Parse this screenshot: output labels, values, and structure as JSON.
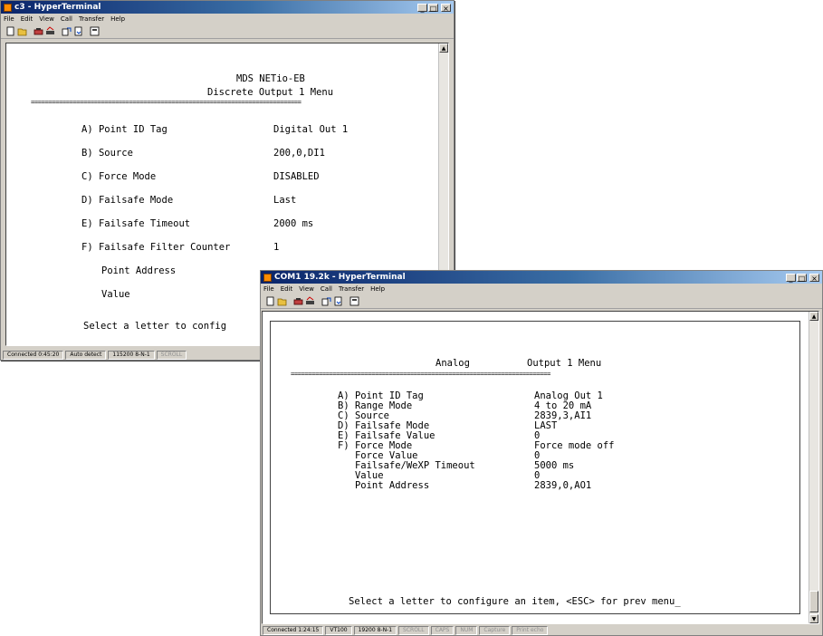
{
  "back_window": {
    "title": "c3 - HyperTerminal",
    "menu": [
      "File",
      "Edit",
      "View",
      "Call",
      "Transfer",
      "Help"
    ],
    "header_line1": "MDS NETio-EB",
    "header_line2": "Discrete Output 1 Menu",
    "separator": "=============================================================================",
    "items": [
      {
        "key": "A) Point ID Tag",
        "value": "Digital Out 1"
      },
      {
        "key": "B) Source",
        "value": "200,0,DI1"
      },
      {
        "key": "C) Force Mode",
        "value": "DISABLED"
      },
      {
        "key": "D) Failsafe Mode",
        "value": "Last"
      },
      {
        "key": "E) Failsafe Timeout",
        "value": "2000 ms"
      },
      {
        "key": "F) Failsafe Filter Counter",
        "value": "1"
      },
      {
        "key": "Point Address",
        "value": ""
      },
      {
        "key": "Value",
        "value": ""
      }
    ],
    "prompt": "Select a letter to config",
    "status": [
      "Connected 0:45:20",
      "Auto detect",
      "115200 8-N-1",
      "SCROLL"
    ]
  },
  "front_window": {
    "title": "COM1 19.2k - HyperTerminal",
    "menu": [
      "File",
      "Edit",
      "View",
      "Call",
      "Transfer",
      "Help"
    ],
    "header_word1": "Analog",
    "header_word2": "Output 1 Menu",
    "separator": "==========================================================================",
    "items": [
      {
        "key": "A) Point ID Tag",
        "value": "Analog Out 1"
      },
      {
        "key": "B) Range Mode",
        "value": "4 to 20 mA"
      },
      {
        "key": "C) Source",
        "value": "2839,3,AI1"
      },
      {
        "key": "D) Failsafe Mode",
        "value": "LAST"
      },
      {
        "key": "E) Failsafe Value",
        "value": "0"
      },
      {
        "key": "F) Force Mode",
        "value": "Force mode off"
      },
      {
        "key": "   Force Value",
        "value": "0"
      },
      {
        "key": "   Failsafe/WeXP Timeout",
        "value": "5000 ms"
      },
      {
        "key": "   Value",
        "value": "0"
      },
      {
        "key": "   Point Address",
        "value": "2839,0,AO1"
      }
    ],
    "prompt": "Select a letter to configure an item, <ESC> for prev menu_",
    "status": [
      "Connected 1:24:15",
      "VT100",
      "19200 8-N-1",
      "SCROLL",
      "CAPS",
      "NUM",
      "Capture",
      "Print echo"
    ]
  },
  "caption_buttons": {
    "minimize": "_",
    "maximize": "□",
    "close": "×"
  },
  "scroll_arrows": {
    "up": "▲",
    "down": "▼"
  },
  "colors": {
    "title_active": "#0a246a",
    "chrome": "#d4d0c8",
    "terminal_bg": "#ffffff"
  }
}
